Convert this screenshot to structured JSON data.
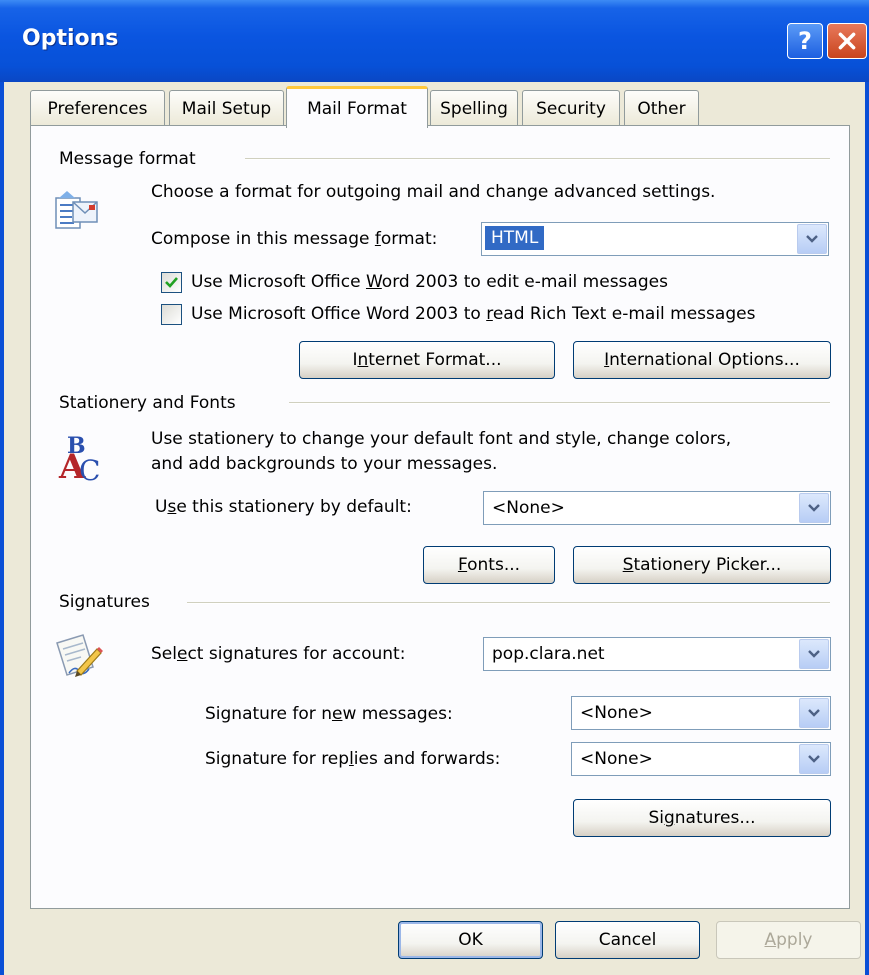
{
  "window": {
    "title": "Options",
    "help_label": "?"
  },
  "tabs": [
    {
      "label": "Preferences"
    },
    {
      "label": "Mail Setup"
    },
    {
      "label": "Mail Format",
      "active": true
    },
    {
      "label": "Spelling"
    },
    {
      "label": "Security"
    },
    {
      "label": "Other"
    }
  ],
  "message_format": {
    "group_label": "Message format",
    "description": "Choose a format for outgoing mail and change advanced settings.",
    "compose_label_pre": "Compose in this message ",
    "compose_label_key": "f",
    "compose_label_post": "ormat:",
    "compose_value": "HTML",
    "word_edit_pre": "Use Microsoft Office ",
    "word_edit_key": "W",
    "word_edit_post": "ord 2003 to edit e-mail messages",
    "word_edit_checked": true,
    "word_read_pre": "Use Microsoft Office Word 2003 to ",
    "word_read_key": "r",
    "word_read_post": "ead Rich Text e-mail messages",
    "word_read_checked": false,
    "internet_btn_pre": "I",
    "internet_btn_key": "n",
    "internet_btn_post": "ternet Format...",
    "international_btn_pre": "",
    "international_btn_key": "I",
    "international_btn_post": "nternational Options..."
  },
  "stationery": {
    "group_label": "Stationery and Fonts",
    "description_line1": "Use stationery to change your default font and style, change colors,",
    "description_line2": "and add backgrounds to your messages.",
    "default_label_pre": "U",
    "default_label_key": "s",
    "default_label_post": "e this stationery by default:",
    "default_value": "<None>",
    "fonts_btn_pre": "",
    "fonts_btn_key": "F",
    "fonts_btn_post": "onts...",
    "picker_btn_pre": "",
    "picker_btn_key": "S",
    "picker_btn_post": "tationery Picker..."
  },
  "signatures": {
    "group_label": "Signatures",
    "account_label_pre": "Sel",
    "account_label_key": "e",
    "account_label_post": "ct signatures for account:",
    "account_value": "pop.clara.net",
    "new_label_pre": "Signature for n",
    "new_label_key": "e",
    "new_label_post": "w messages:",
    "new_value": "<None>",
    "replies_label_pre": "Signature for rep",
    "replies_label_key": "l",
    "replies_label_post": "ies and forwards:",
    "replies_value": "<None>",
    "signatures_btn_pre": "Si",
    "signatures_btn_key": "g",
    "signatures_btn_post": "natures..."
  },
  "footer": {
    "ok_label": "OK",
    "cancel_label": "Cancel",
    "apply_pre": "",
    "apply_key": "A",
    "apply_post": "pply"
  },
  "colors": {
    "titlebar": "#0a55e0",
    "selection": "#316ac5",
    "active_tab_highlight": "#ffc83c",
    "dialog_face": "#ece9d8"
  }
}
